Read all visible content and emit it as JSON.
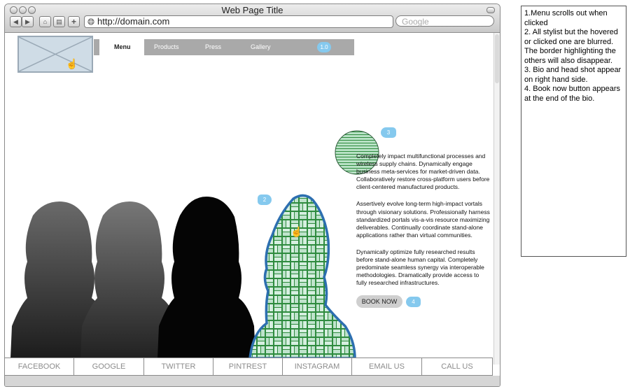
{
  "browser": {
    "window_title": "Web Page Title",
    "url": "http://domain.com",
    "search_placeholder": "Google",
    "buttons": {
      "back": "◀",
      "forward": "▶",
      "home": "⌂",
      "print": "▤",
      "add": "+"
    }
  },
  "site": {
    "menu_items": [
      "Menu",
      "Products",
      "Press",
      "Gallery"
    ],
    "annotations": {
      "menu": "1.0",
      "stylist": "2",
      "bio": "3",
      "book": "4"
    },
    "bio_paragraphs": [
      "Completely impact multifunctional processes and wireless supply chains. Dynamically engage business meta-services for market-driven data. Collaboratively restore cross-platform users before client-centered manufactured products.",
      "Assertively evolve long-term high-impact vortals through visionary solutions. Professionally harness standardized portals vis-a-vis resource maximizing deliverables. Continually coordinate stand-alone applications rather than virtual communities.",
      "Dynamically optimize fully researched results before stand-alone human capital. Completely predominate seamless synergy via interoperable methodologies. Dramatically provide access to fully researched infrastructures."
    ],
    "book_now": "BOOK NOW",
    "footer_links": [
      "FACEBOOK",
      "GOOGLE",
      "TWITTER",
      "PINTREST",
      "INSTAGRAM",
      "EMAIL US",
      "CALL US"
    ]
  },
  "notes": [
    "1.Menu scrolls out when clicked",
    "2. All stylist but the hovered or clicked one are blurred. The border highlighting the others will also disappear.",
    "3. Bio and head shot appear on right hand side.",
    "4. Book now button appears at the end of the bio."
  ],
  "colors": {
    "accent_blue": "#85c9ee",
    "menu_gray": "#a9a9a9",
    "highlight_border": "#2d6fb0",
    "pattern_green": "#2e8b3e",
    "pattern_light": "#bfe3cc"
  },
  "icons": {
    "cursor": "hand-pointer-icon",
    "logo": "image-placeholder-icon",
    "site_icon": "globe-icon"
  }
}
